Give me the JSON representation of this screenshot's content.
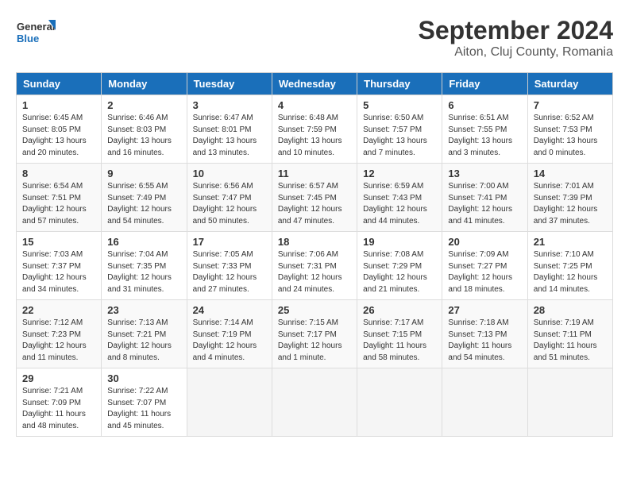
{
  "header": {
    "logo_line1": "General",
    "logo_line2": "Blue",
    "month": "September 2024",
    "location": "Aiton, Cluj County, Romania"
  },
  "days_of_week": [
    "Sunday",
    "Monday",
    "Tuesday",
    "Wednesday",
    "Thursday",
    "Friday",
    "Saturday"
  ],
  "weeks": [
    [
      {
        "day": "1",
        "sunrise": "6:45 AM",
        "sunset": "8:05 PM",
        "daylight": "13 hours and 20 minutes."
      },
      {
        "day": "2",
        "sunrise": "6:46 AM",
        "sunset": "8:03 PM",
        "daylight": "13 hours and 16 minutes."
      },
      {
        "day": "3",
        "sunrise": "6:47 AM",
        "sunset": "8:01 PM",
        "daylight": "13 hours and 13 minutes."
      },
      {
        "day": "4",
        "sunrise": "6:48 AM",
        "sunset": "7:59 PM",
        "daylight": "13 hours and 10 minutes."
      },
      {
        "day": "5",
        "sunrise": "6:50 AM",
        "sunset": "7:57 PM",
        "daylight": "13 hours and 7 minutes."
      },
      {
        "day": "6",
        "sunrise": "6:51 AM",
        "sunset": "7:55 PM",
        "daylight": "13 hours and 3 minutes."
      },
      {
        "day": "7",
        "sunrise": "6:52 AM",
        "sunset": "7:53 PM",
        "daylight": "13 hours and 0 minutes."
      }
    ],
    [
      {
        "day": "8",
        "sunrise": "6:54 AM",
        "sunset": "7:51 PM",
        "daylight": "12 hours and 57 minutes."
      },
      {
        "day": "9",
        "sunrise": "6:55 AM",
        "sunset": "7:49 PM",
        "daylight": "12 hours and 54 minutes."
      },
      {
        "day": "10",
        "sunrise": "6:56 AM",
        "sunset": "7:47 PM",
        "daylight": "12 hours and 50 minutes."
      },
      {
        "day": "11",
        "sunrise": "6:57 AM",
        "sunset": "7:45 PM",
        "daylight": "12 hours and 47 minutes."
      },
      {
        "day": "12",
        "sunrise": "6:59 AM",
        "sunset": "7:43 PM",
        "daylight": "12 hours and 44 minutes."
      },
      {
        "day": "13",
        "sunrise": "7:00 AM",
        "sunset": "7:41 PM",
        "daylight": "12 hours and 41 minutes."
      },
      {
        "day": "14",
        "sunrise": "7:01 AM",
        "sunset": "7:39 PM",
        "daylight": "12 hours and 37 minutes."
      }
    ],
    [
      {
        "day": "15",
        "sunrise": "7:03 AM",
        "sunset": "7:37 PM",
        "daylight": "12 hours and 34 minutes."
      },
      {
        "day": "16",
        "sunrise": "7:04 AM",
        "sunset": "7:35 PM",
        "daylight": "12 hours and 31 minutes."
      },
      {
        "day": "17",
        "sunrise": "7:05 AM",
        "sunset": "7:33 PM",
        "daylight": "12 hours and 27 minutes."
      },
      {
        "day": "18",
        "sunrise": "7:06 AM",
        "sunset": "7:31 PM",
        "daylight": "12 hours and 24 minutes."
      },
      {
        "day": "19",
        "sunrise": "7:08 AM",
        "sunset": "7:29 PM",
        "daylight": "12 hours and 21 minutes."
      },
      {
        "day": "20",
        "sunrise": "7:09 AM",
        "sunset": "7:27 PM",
        "daylight": "12 hours and 18 minutes."
      },
      {
        "day": "21",
        "sunrise": "7:10 AM",
        "sunset": "7:25 PM",
        "daylight": "12 hours and 14 minutes."
      }
    ],
    [
      {
        "day": "22",
        "sunrise": "7:12 AM",
        "sunset": "7:23 PM",
        "daylight": "12 hours and 11 minutes."
      },
      {
        "day": "23",
        "sunrise": "7:13 AM",
        "sunset": "7:21 PM",
        "daylight": "12 hours and 8 minutes."
      },
      {
        "day": "24",
        "sunrise": "7:14 AM",
        "sunset": "7:19 PM",
        "daylight": "12 hours and 4 minutes."
      },
      {
        "day": "25",
        "sunrise": "7:15 AM",
        "sunset": "7:17 PM",
        "daylight": "12 hours and 1 minute."
      },
      {
        "day": "26",
        "sunrise": "7:17 AM",
        "sunset": "7:15 PM",
        "daylight": "11 hours and 58 minutes."
      },
      {
        "day": "27",
        "sunrise": "7:18 AM",
        "sunset": "7:13 PM",
        "daylight": "11 hours and 54 minutes."
      },
      {
        "day": "28",
        "sunrise": "7:19 AM",
        "sunset": "7:11 PM",
        "daylight": "11 hours and 51 minutes."
      }
    ],
    [
      {
        "day": "29",
        "sunrise": "7:21 AM",
        "sunset": "7:09 PM",
        "daylight": "11 hours and 48 minutes."
      },
      {
        "day": "30",
        "sunrise": "7:22 AM",
        "sunset": "7:07 PM",
        "daylight": "11 hours and 45 minutes."
      },
      null,
      null,
      null,
      null,
      null
    ]
  ]
}
